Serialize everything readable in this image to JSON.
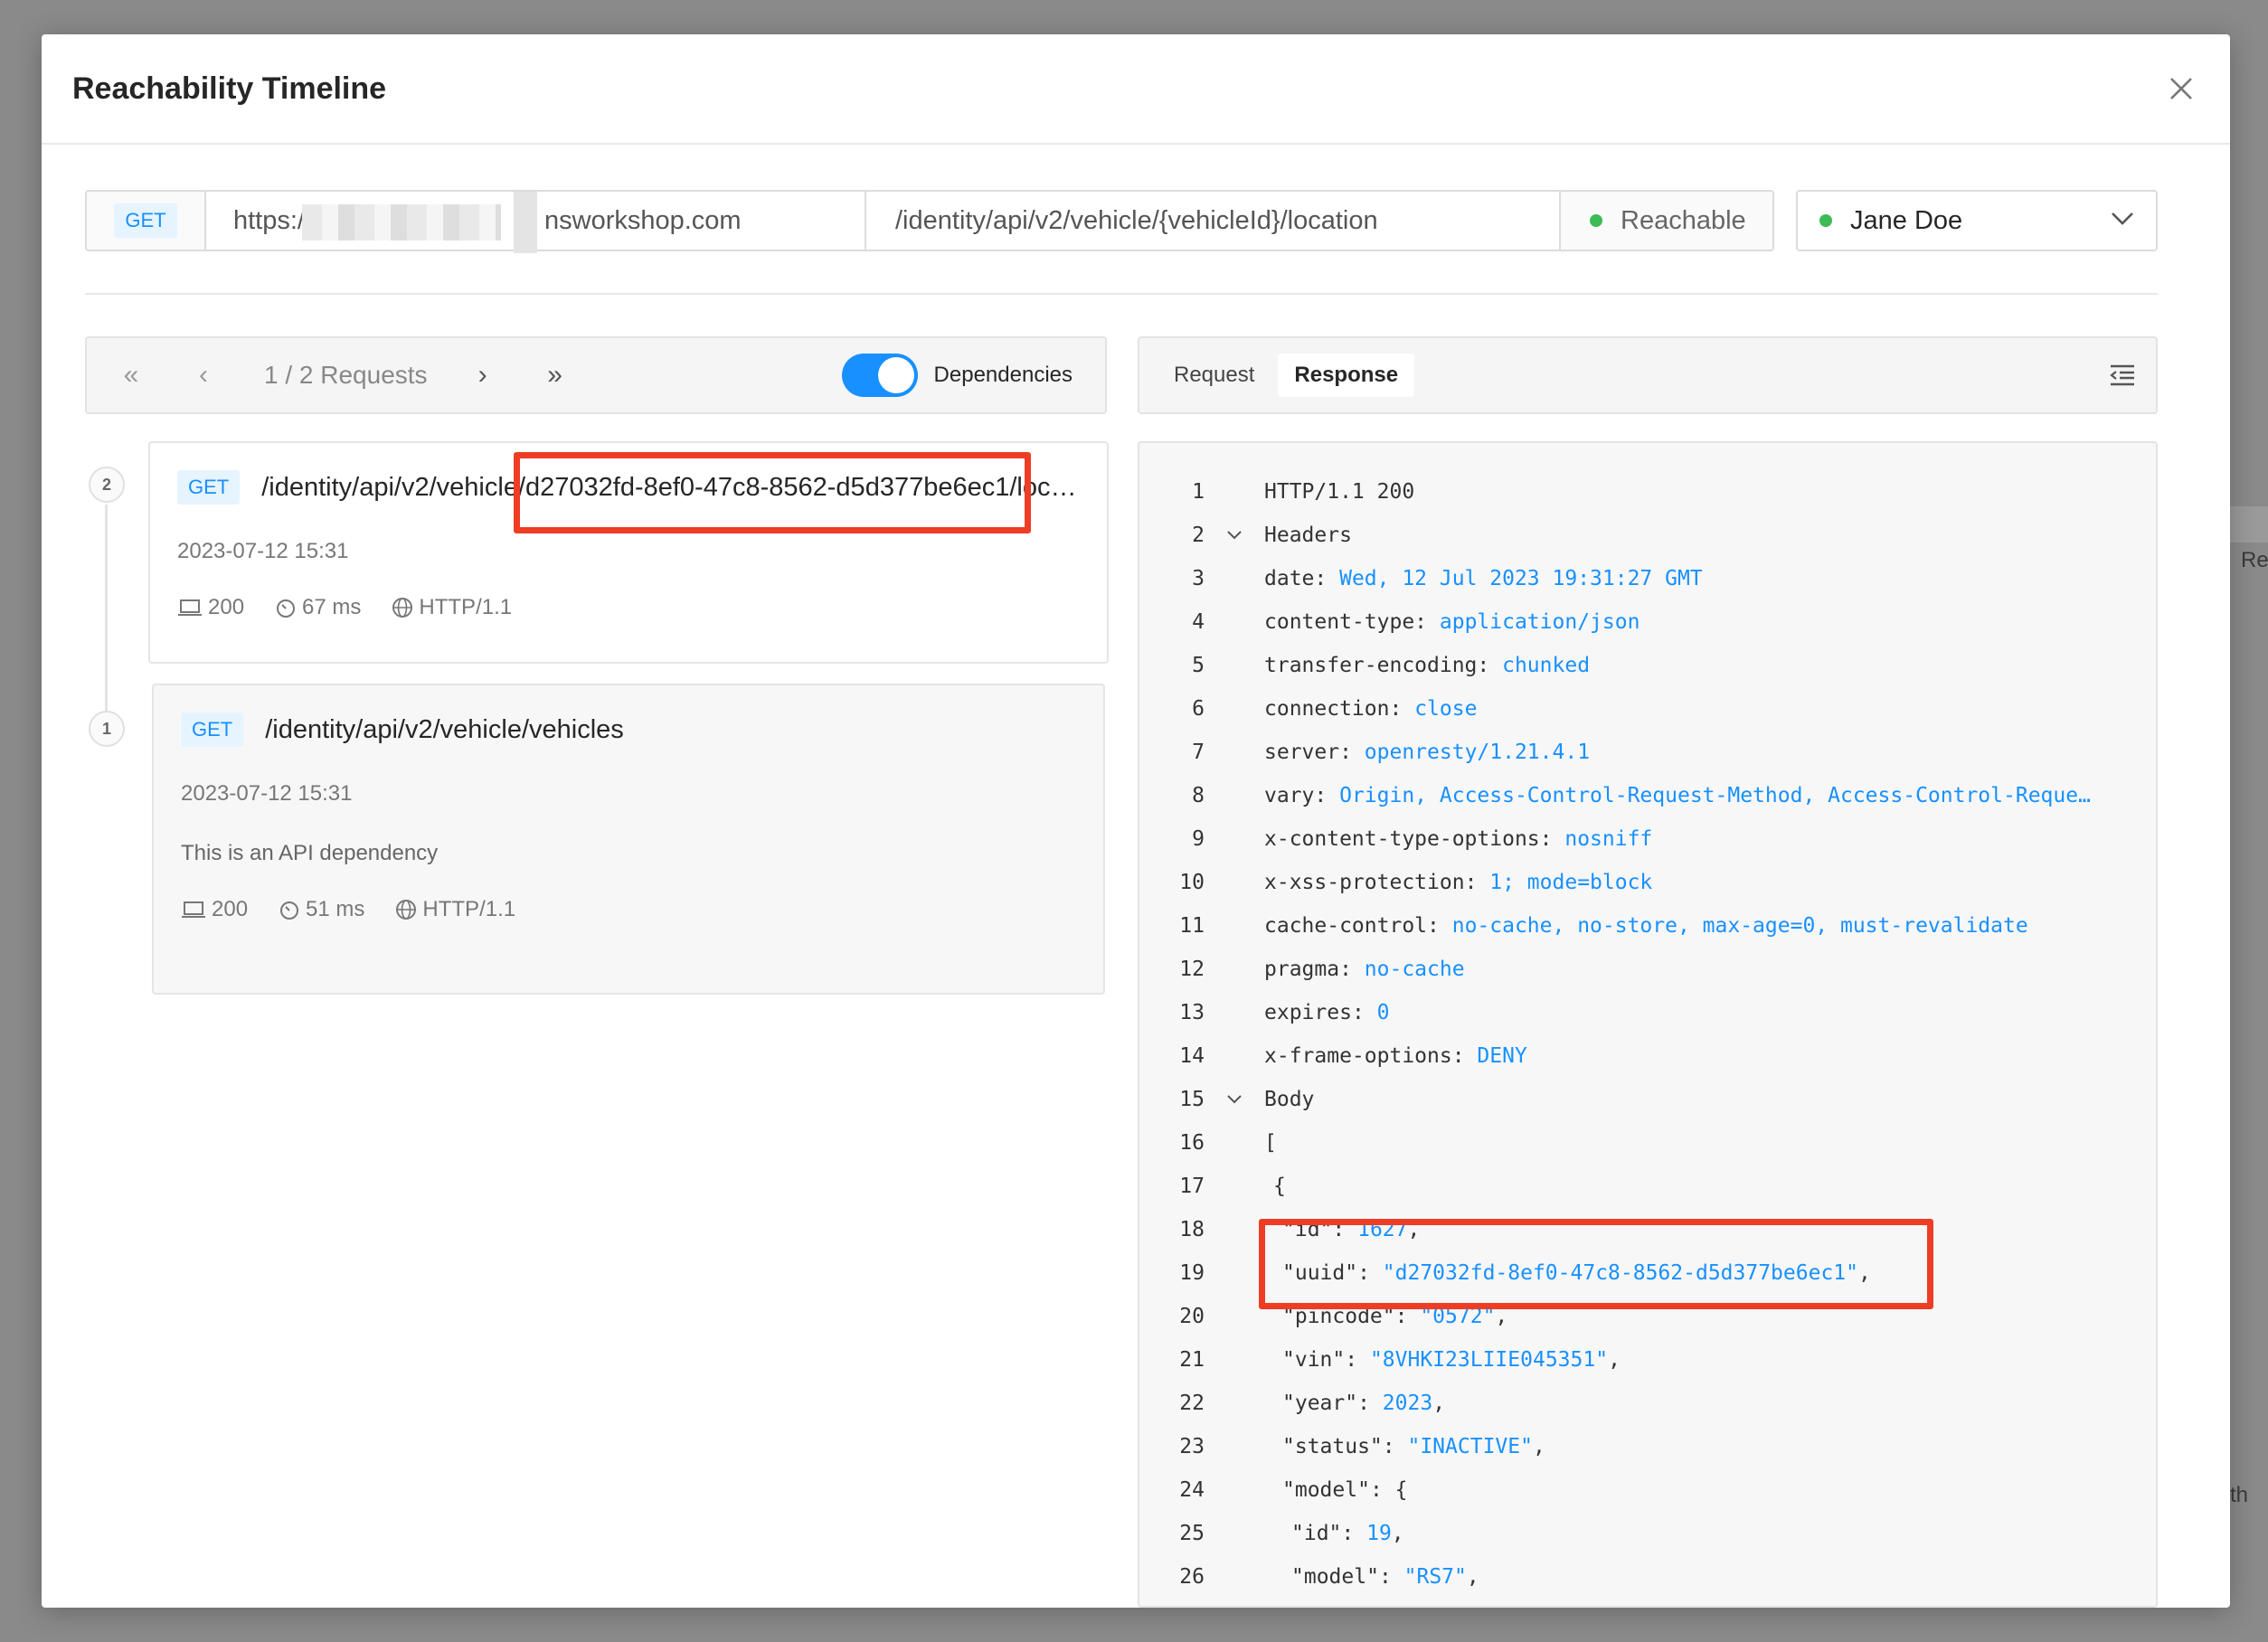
{
  "modal": {
    "title": "Reachability Timeline"
  },
  "url_bar": {
    "method": "GET",
    "host": "https:/",
    "host_suffix": "nsworkshop.com",
    "path": "/identity/api/v2/vehicle/{vehicleId}/location",
    "status": "Reachable"
  },
  "user_select": {
    "value": "Jane Doe"
  },
  "nav": {
    "count_label": "1 / 2 Requests",
    "toggle_label": "Dependencies",
    "toggle_on": true
  },
  "tabs": [
    {
      "label": "Request",
      "active": false
    },
    {
      "label": "Response",
      "active": true
    }
  ],
  "requests": [
    {
      "index": "2",
      "method": "GET",
      "path": "/identity/api/v2/vehicle/d27032fd-8ef0-47c8-8562-d5d377be6ec1/loc…",
      "time": "2023-07-12 15:31",
      "status": "200",
      "duration": "67 ms",
      "protocol": "HTTP/1.1"
    },
    {
      "index": "1",
      "method": "GET",
      "path": "/identity/api/v2/vehicle/vehicles",
      "time": "2023-07-12 15:31",
      "description": "This is an API dependency",
      "status": "200",
      "duration": "51 ms",
      "protocol": "HTTP/1.1"
    }
  ],
  "response_lines": [
    {
      "n": "1",
      "fold": false,
      "indent": 0,
      "key": "HTTP/1.1 200",
      "sep": "",
      "val": ""
    },
    {
      "n": "2",
      "fold": true,
      "indent": 0,
      "key": "Headers",
      "sep": "",
      "val": ""
    },
    {
      "n": "3",
      "fold": false,
      "indent": 0,
      "key": "date",
      "sep": ": ",
      "val": "Wed, 12 Jul 2023 19:31:27 GMT"
    },
    {
      "n": "4",
      "fold": false,
      "indent": 0,
      "key": "content-type",
      "sep": ": ",
      "val": "application/json"
    },
    {
      "n": "5",
      "fold": false,
      "indent": 0,
      "key": "transfer-encoding",
      "sep": ": ",
      "val": "chunked"
    },
    {
      "n": "6",
      "fold": false,
      "indent": 0,
      "key": "connection",
      "sep": ": ",
      "val": "close"
    },
    {
      "n": "7",
      "fold": false,
      "indent": 0,
      "key": "server",
      "sep": ": ",
      "val": "openresty/1.21.4.1"
    },
    {
      "n": "8",
      "fold": false,
      "indent": 0,
      "key": "vary",
      "sep": ": ",
      "val": "Origin, Access-Control-Request-Method, Access-Control-Reque…"
    },
    {
      "n": "9",
      "fold": false,
      "indent": 0,
      "key": "x-content-type-options",
      "sep": ": ",
      "val": "nosniff"
    },
    {
      "n": "10",
      "fold": false,
      "indent": 0,
      "key": "x-xss-protection",
      "sep": ": ",
      "val": "1; mode=block"
    },
    {
      "n": "11",
      "fold": false,
      "indent": 0,
      "key": "cache-control",
      "sep": ": ",
      "val": "no-cache, no-store, max-age=0, must-revalidate"
    },
    {
      "n": "12",
      "fold": false,
      "indent": 0,
      "key": "pragma",
      "sep": ": ",
      "val": "no-cache"
    },
    {
      "n": "13",
      "fold": false,
      "indent": 0,
      "key": "expires",
      "sep": ": ",
      "val": "0"
    },
    {
      "n": "14",
      "fold": false,
      "indent": 0,
      "key": "x-frame-options",
      "sep": ": ",
      "val": "DENY"
    },
    {
      "n": "15",
      "fold": true,
      "indent": 0,
      "key": "Body",
      "sep": "",
      "val": ""
    },
    {
      "n": "16",
      "fold": false,
      "indent": 0,
      "key": "[",
      "sep": "",
      "val": ""
    },
    {
      "n": "17",
      "fold": false,
      "indent": 1,
      "key": "{",
      "sep": "",
      "val": ""
    },
    {
      "n": "18",
      "fold": false,
      "indent": 2,
      "key": "\"id\"",
      "sep": ": ",
      "val": "1627",
      "tail": ","
    },
    {
      "n": "19",
      "fold": false,
      "indent": 2,
      "key": "\"uuid\"",
      "sep": ": ",
      "val": "\"d27032fd-8ef0-47c8-8562-d5d377be6ec1\"",
      "tail": ","
    },
    {
      "n": "20",
      "fold": false,
      "indent": 2,
      "key": "\"pincode\"",
      "sep": ": ",
      "val": "\"0572\"",
      "tail": ","
    },
    {
      "n": "21",
      "fold": false,
      "indent": 2,
      "key": "\"vin\"",
      "sep": ": ",
      "val": "\"8VHKI23LIIE045351\"",
      "tail": ","
    },
    {
      "n": "22",
      "fold": false,
      "indent": 2,
      "key": "\"year\"",
      "sep": ": ",
      "val": "2023",
      "tail": ","
    },
    {
      "n": "23",
      "fold": false,
      "indent": 2,
      "key": "\"status\"",
      "sep": ": ",
      "val": "\"INACTIVE\"",
      "tail": ","
    },
    {
      "n": "24",
      "fold": false,
      "indent": 2,
      "key": "\"model\"",
      "sep": ": ",
      "val": "",
      "tail": "{"
    },
    {
      "n": "25",
      "fold": false,
      "indent": 3,
      "key": "\"id\"",
      "sep": ": ",
      "val": "19",
      "tail": ","
    },
    {
      "n": "26",
      "fold": false,
      "indent": 3,
      "key": "\"model\"",
      "sep": ": ",
      "val": "\"RS7\"",
      "tail": ","
    }
  ],
  "backdrop": {
    "side_text_1": "Re",
    "side_text_2": "th"
  },
  "colors": {
    "accent": "#1890ff",
    "reachable": "#3dbb55",
    "highlight": "#ee3d25"
  }
}
